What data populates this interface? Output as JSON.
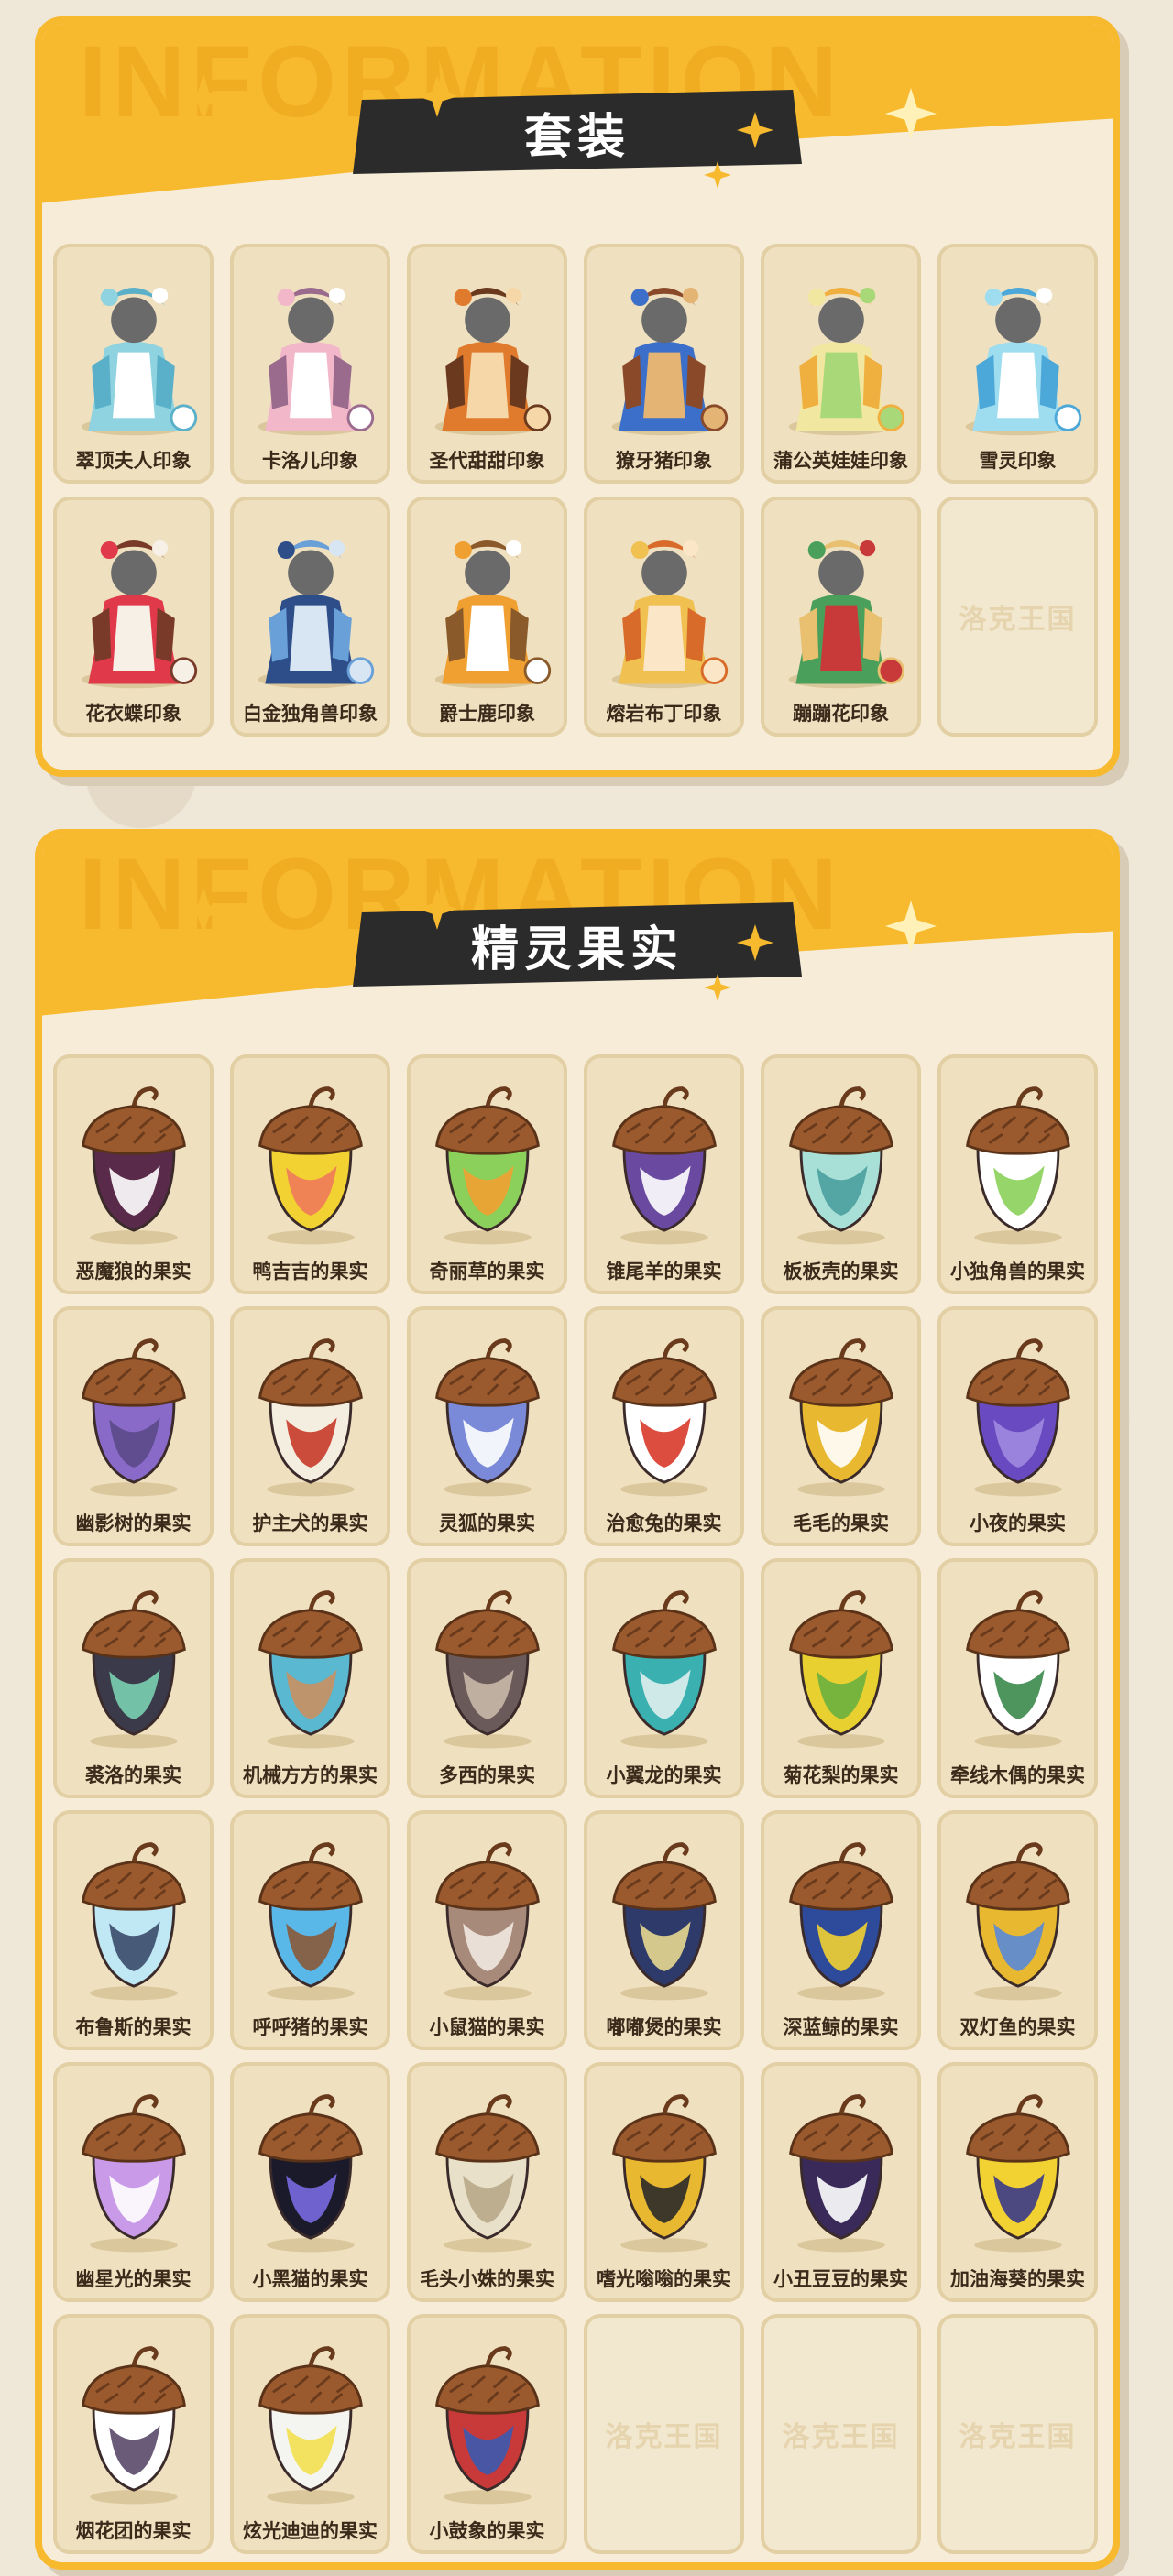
{
  "sections": [
    {
      "title": "套装",
      "ghost_text": "INFORMATION",
      "items": [
        {
          "label": "翠顶夫人印象",
          "colors": [
            "#8fd3e0",
            "#ffffff",
            "#5ab0c8"
          ],
          "empty": false
        },
        {
          "label": "卡洛儿印象",
          "colors": [
            "#f2b7c8",
            "#ffffff",
            "#9a6b8c"
          ],
          "empty": false
        },
        {
          "label": "圣代甜甜印象",
          "colors": [
            "#e07b2e",
            "#f6d8a8",
            "#6b3a1e"
          ],
          "empty": false
        },
        {
          "label": "獠牙猪印象",
          "colors": [
            "#3c6fc9",
            "#e3b473",
            "#8a4a2a"
          ],
          "empty": false
        },
        {
          "label": "蒲公英娃娃印象",
          "colors": [
            "#f2e7a0",
            "#a8d878",
            "#f0b040"
          ],
          "empty": false
        },
        {
          "label": "雪灵印象",
          "colors": [
            "#9edcf0",
            "#ffffff",
            "#4ba8d8"
          ],
          "empty": false
        },
        {
          "label": "花衣蝶印象",
          "colors": [
            "#e03a4a",
            "#f6f0e6",
            "#7a3a2a"
          ],
          "empty": false
        },
        {
          "label": "白金独角兽印象",
          "colors": [
            "#2e4e8a",
            "#d8e6f4",
            "#6aa0d8"
          ],
          "empty": false
        },
        {
          "label": "爵士鹿印象",
          "colors": [
            "#f0a030",
            "#ffffff",
            "#8a5a2a"
          ],
          "empty": false
        },
        {
          "label": "熔岩布丁印象",
          "colors": [
            "#f0c050",
            "#fbe6c8",
            "#d86a2a"
          ],
          "empty": false
        },
        {
          "label": "蹦蹦花印象",
          "colors": [
            "#4aa05a",
            "#c83a3a",
            "#e8c070"
          ],
          "empty": false
        },
        {
          "label": "",
          "watermark": "洛克王国",
          "empty": true
        }
      ]
    },
    {
      "title": "精灵果实",
      "ghost_text": "INFORMATION",
      "items": [
        {
          "label": "恶魔狼的果实",
          "colors": [
            "#5a2a4a",
            "#ffffff"
          ],
          "empty": false
        },
        {
          "label": "鸭吉吉的果实",
          "colors": [
            "#f2d232",
            "#f07a5a"
          ],
          "empty": false
        },
        {
          "label": "奇丽草的果实",
          "colors": [
            "#8ad05a",
            "#f0a030"
          ],
          "empty": false
        },
        {
          "label": "锥尾羊的果实",
          "colors": [
            "#6a4aa0",
            "#ffffff"
          ],
          "empty": false
        },
        {
          "label": "板板壳的果实",
          "colors": [
            "#a8e0d8",
            "#4aa0a0"
          ],
          "empty": false
        },
        {
          "label": "小独角兽的果实",
          "colors": [
            "#ffffff",
            "#8ad05a"
          ],
          "empty": false
        },
        {
          "label": "幽影树的果实",
          "colors": [
            "#8a6ac8",
            "#5a4a8a"
          ],
          "empty": false
        },
        {
          "label": "护主犬的果实",
          "colors": [
            "#f4eee0",
            "#c83a2a"
          ],
          "empty": false
        },
        {
          "label": "灵狐的果实",
          "colors": [
            "#7a8ad8",
            "#ffffff"
          ],
          "empty": false
        },
        {
          "label": "治愈兔的果实",
          "colors": [
            "#ffffff",
            "#d83a2a"
          ],
          "empty": false
        },
        {
          "label": "毛毛的果实",
          "colors": [
            "#e8b830",
            "#ffffff"
          ],
          "empty": false
        },
        {
          "label": "小夜的果实",
          "colors": [
            "#6a4ac0",
            "#a08ae0"
          ],
          "empty": false
        },
        {
          "label": "裘洛的果实",
          "colors": [
            "#3a3a4a",
            "#7ad0b0"
          ],
          "empty": false
        },
        {
          "label": "机械方方的果实",
          "colors": [
            "#5ab8d0",
            "#c89060"
          ],
          "empty": false
        },
        {
          "label": "多西的果实",
          "colors": [
            "#6a5a5a",
            "#c8b8a8"
          ],
          "empty": false
        },
        {
          "label": "小翼龙的果实",
          "colors": [
            "#3ab0b0",
            "#e0f0f0"
          ],
          "empty": false
        },
        {
          "label": "菊花梨的果实",
          "colors": [
            "#e8d030",
            "#6ab040"
          ],
          "empty": false
        },
        {
          "label": "牵线木偶的果实",
          "colors": [
            "#ffffff",
            "#3a8a4a"
          ],
          "empty": false
        },
        {
          "label": "布鲁斯的果实",
          "colors": [
            "#bfe8f4",
            "#3a4a6a"
          ],
          "empty": false
        },
        {
          "label": "呼呼猪的果实",
          "colors": [
            "#5ab8e8",
            "#8a5a3a"
          ],
          "empty": false
        },
        {
          "label": "小鼠猫的果实",
          "colors": [
            "#a88a7a",
            "#f0e8e0"
          ],
          "empty": false
        },
        {
          "label": "嘟嘟煲的果实",
          "colors": [
            "#2e3a6a",
            "#e8d890"
          ],
          "empty": false
        },
        {
          "label": "深蓝鲸的果实",
          "colors": [
            "#2e4a9a",
            "#f2d232"
          ],
          "empty": false
        },
        {
          "label": "双灯鱼的果实",
          "colors": [
            "#e8b830",
            "#5a8ad8"
          ],
          "empty": false
        },
        {
          "label": "幽星光的果实",
          "colors": [
            "#c89ae8",
            "#ffffff"
          ],
          "empty": false
        },
        {
          "label": "小黑猫的果实",
          "colors": [
            "#1a1a2a",
            "#7a6ae0"
          ],
          "empty": false
        },
        {
          "label": "毛头小姝的果实",
          "colors": [
            "#e8e0c8",
            "#b8a888"
          ],
          "empty": false
        },
        {
          "label": "嗜光嗡嗡的果实",
          "colors": [
            "#e8b830",
            "#2a2a2a"
          ],
          "empty": false
        },
        {
          "label": "小丑豆豆的果实",
          "colors": [
            "#3a2a5a",
            "#ffffff"
          ],
          "empty": false
        },
        {
          "label": "加油海葵的果实",
          "colors": [
            "#f2d232",
            "#3a3a8a"
          ],
          "empty": false
        },
        {
          "label": "烟花团的果实",
          "colors": [
            "#ffffff",
            "#5a4a6a"
          ],
          "empty": false
        },
        {
          "label": "炫光迪迪的果实",
          "colors": [
            "#f4f4f0",
            "#f2e050"
          ],
          "empty": false
        },
        {
          "label": "小鼓象的果实",
          "colors": [
            "#c83a3a",
            "#3a5ab0"
          ],
          "empty": false
        },
        {
          "label": "",
          "watermark": "洛克王国",
          "empty": true
        },
        {
          "label": "",
          "watermark": "洛克王国",
          "empty": true
        },
        {
          "label": "",
          "watermark": "洛克王国",
          "empty": true
        }
      ]
    }
  ]
}
